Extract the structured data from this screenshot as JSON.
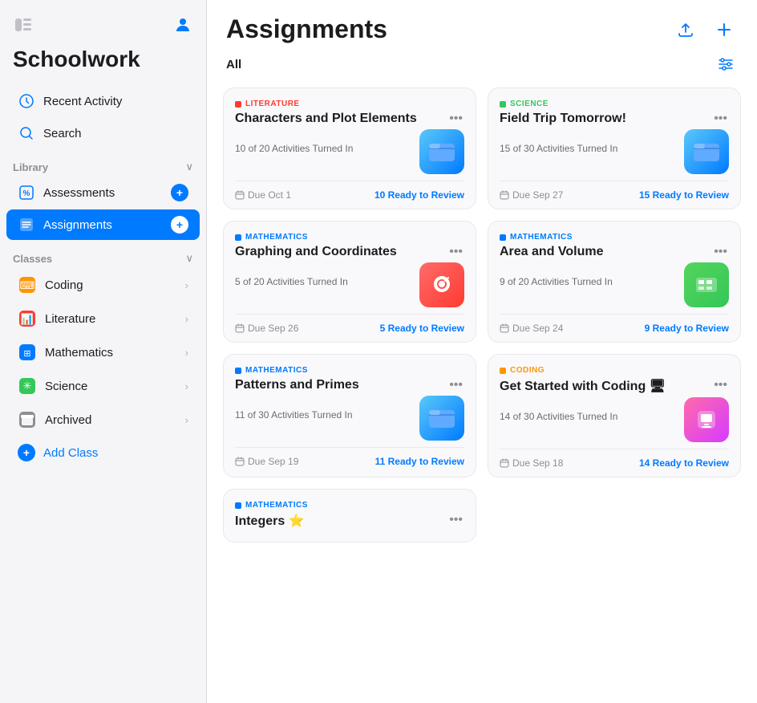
{
  "sidebar": {
    "toggle_icon": "⊞",
    "profile_icon": "👤",
    "title": "Schoolwork",
    "nav": [
      {
        "id": "recent-activity",
        "label": "Recent Activity",
        "icon": "🕐"
      },
      {
        "id": "search",
        "label": "Search",
        "icon": "🔍"
      }
    ],
    "library_section": {
      "title": "Library",
      "items": [
        {
          "id": "assessments",
          "label": "Assessments",
          "icon": "%"
        },
        {
          "id": "assignments",
          "label": "Assignments",
          "icon": "☰",
          "active": true
        }
      ]
    },
    "classes_section": {
      "title": "Classes",
      "items": [
        {
          "id": "coding",
          "label": "Coding",
          "color": "#ff9500"
        },
        {
          "id": "literature",
          "label": "Literature",
          "color": "#ff3b30"
        },
        {
          "id": "mathematics",
          "label": "Mathematics",
          "color": "#007aff"
        },
        {
          "id": "science",
          "label": "Science",
          "color": "#34c759"
        },
        {
          "id": "archived",
          "label": "Archived",
          "color": "#8e8e93"
        }
      ]
    },
    "add_class_label": "+ Add Class"
  },
  "main": {
    "title": "Assignments",
    "filter_label": "All",
    "upload_icon": "⬆",
    "add_icon": "+",
    "filter_sliders_icon": "⊞",
    "assignments": [
      {
        "id": "characters-plot",
        "subject": "LITERATURE",
        "subject_color": "#ff3b30",
        "title": "Characters and Plot Elements",
        "activities": "10 of 20 Activities Turned In",
        "due": "Due Oct 1",
        "review": "10 Ready to Review",
        "icon_type": "folder-blue",
        "icon_emoji": "📁"
      },
      {
        "id": "field-trip",
        "subject": "SCIENCE",
        "subject_color": "#34c759",
        "title": "Field Trip Tomorrow!",
        "activities": "15 of 30 Activities Turned In",
        "due": "Due Sep 27",
        "review": "15 Ready to Review",
        "icon_type": "folder-blue",
        "icon_emoji": "📁"
      },
      {
        "id": "graphing-coordinates",
        "subject": "MATHEMATICS",
        "subject_color": "#007aff",
        "title": "Graphing and Coordinates",
        "activities": "5 of 20 Activities Turned In",
        "due": "Due Sep 26",
        "review": "5 Ready to Review",
        "icon_type": "swift",
        "icon_emoji": "🐦"
      },
      {
        "id": "area-volume",
        "subject": "MATHEMATICS",
        "subject_color": "#007aff",
        "title": "Area and Volume",
        "activities": "9 of 20 Activities Turned In",
        "due": "Due Sep 24",
        "review": "9 Ready to Review",
        "icon_type": "numbers",
        "icon_emoji": "📊"
      },
      {
        "id": "patterns-primes",
        "subject": "MATHEMATICS",
        "subject_color": "#007aff",
        "title": "Patterns and Primes",
        "activities": "11 of 30 Activities Turned In",
        "due": "Due Sep 19",
        "review": "11 Ready to Review",
        "icon_type": "folder-blue",
        "icon_emoji": "📁"
      },
      {
        "id": "get-started-coding",
        "subject": "CODING",
        "subject_color": "#ff9500",
        "title": "Get Started with Coding 🖥",
        "activities": "14 of 30 Activities Turned In",
        "due": "Due Sep 18",
        "review": "14 Ready to Review",
        "icon_type": "keynote",
        "icon_emoji": "🎯"
      },
      {
        "id": "integers",
        "subject": "MATHEMATICS",
        "subject_color": "#007aff",
        "title": "Integers ⭐",
        "activities": "",
        "due": "",
        "review": "",
        "icon_type": "folder-blue",
        "icon_emoji": "📁",
        "partial": true
      }
    ]
  }
}
